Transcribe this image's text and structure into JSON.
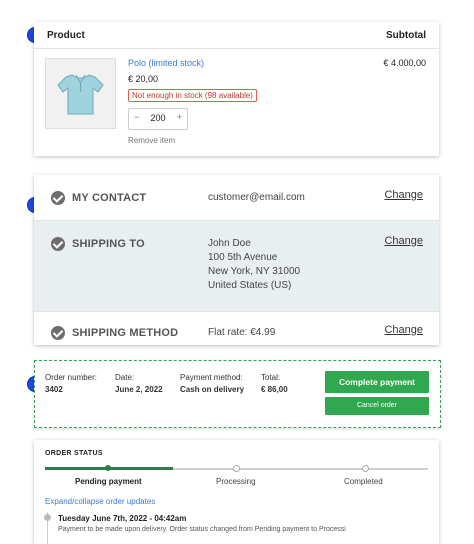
{
  "product": {
    "header_product": "Product",
    "header_subtotal": "Subtotal",
    "name": "Polo (limited stock)",
    "price": "€ 20,00",
    "stock_warning": "Not enough in stock (98 available)",
    "quantity": "200",
    "remove_label": "Remove item",
    "subtotal": "€ 4.000,00"
  },
  "steps": [
    {
      "title": "MY CONTACT",
      "value": "customer@email.com",
      "change": "Change"
    },
    {
      "title": "SHIPPING TO",
      "address": [
        "John Doe",
        "100 5th Avenue",
        "New York, NY 31000",
        "United States (US)"
      ],
      "change": "Change"
    },
    {
      "title": "SHIPPING METHOD",
      "value": "Flat rate: €4.99",
      "change": "Change"
    }
  ],
  "order": {
    "number_label": "Order number:",
    "number": "3402",
    "date_label": "Date:",
    "date": "June 2, 2022",
    "payment_label": "Payment method:",
    "payment": "Cash on delivery",
    "total_label": "Total:",
    "total": "€ 86,00",
    "complete_button": "Complete payment",
    "cancel_button": "Cancel order"
  },
  "status": {
    "title": "ORDER STATUS",
    "stages": [
      "Pending payment",
      "Processing",
      "Completed"
    ],
    "expand_label": "Expand/collapse order updates",
    "update_date": "Tuesday June 7th, 2022 - 04:42am",
    "update_text": "Payment to be made upon delivery. Order status changed from Pending payment to Processi"
  },
  "colors": {
    "accent_green": "#2fa84f",
    "link_blue": "#3a7bd5",
    "marker_blue": "#1f49e0",
    "warning_red": "#c0392b"
  }
}
